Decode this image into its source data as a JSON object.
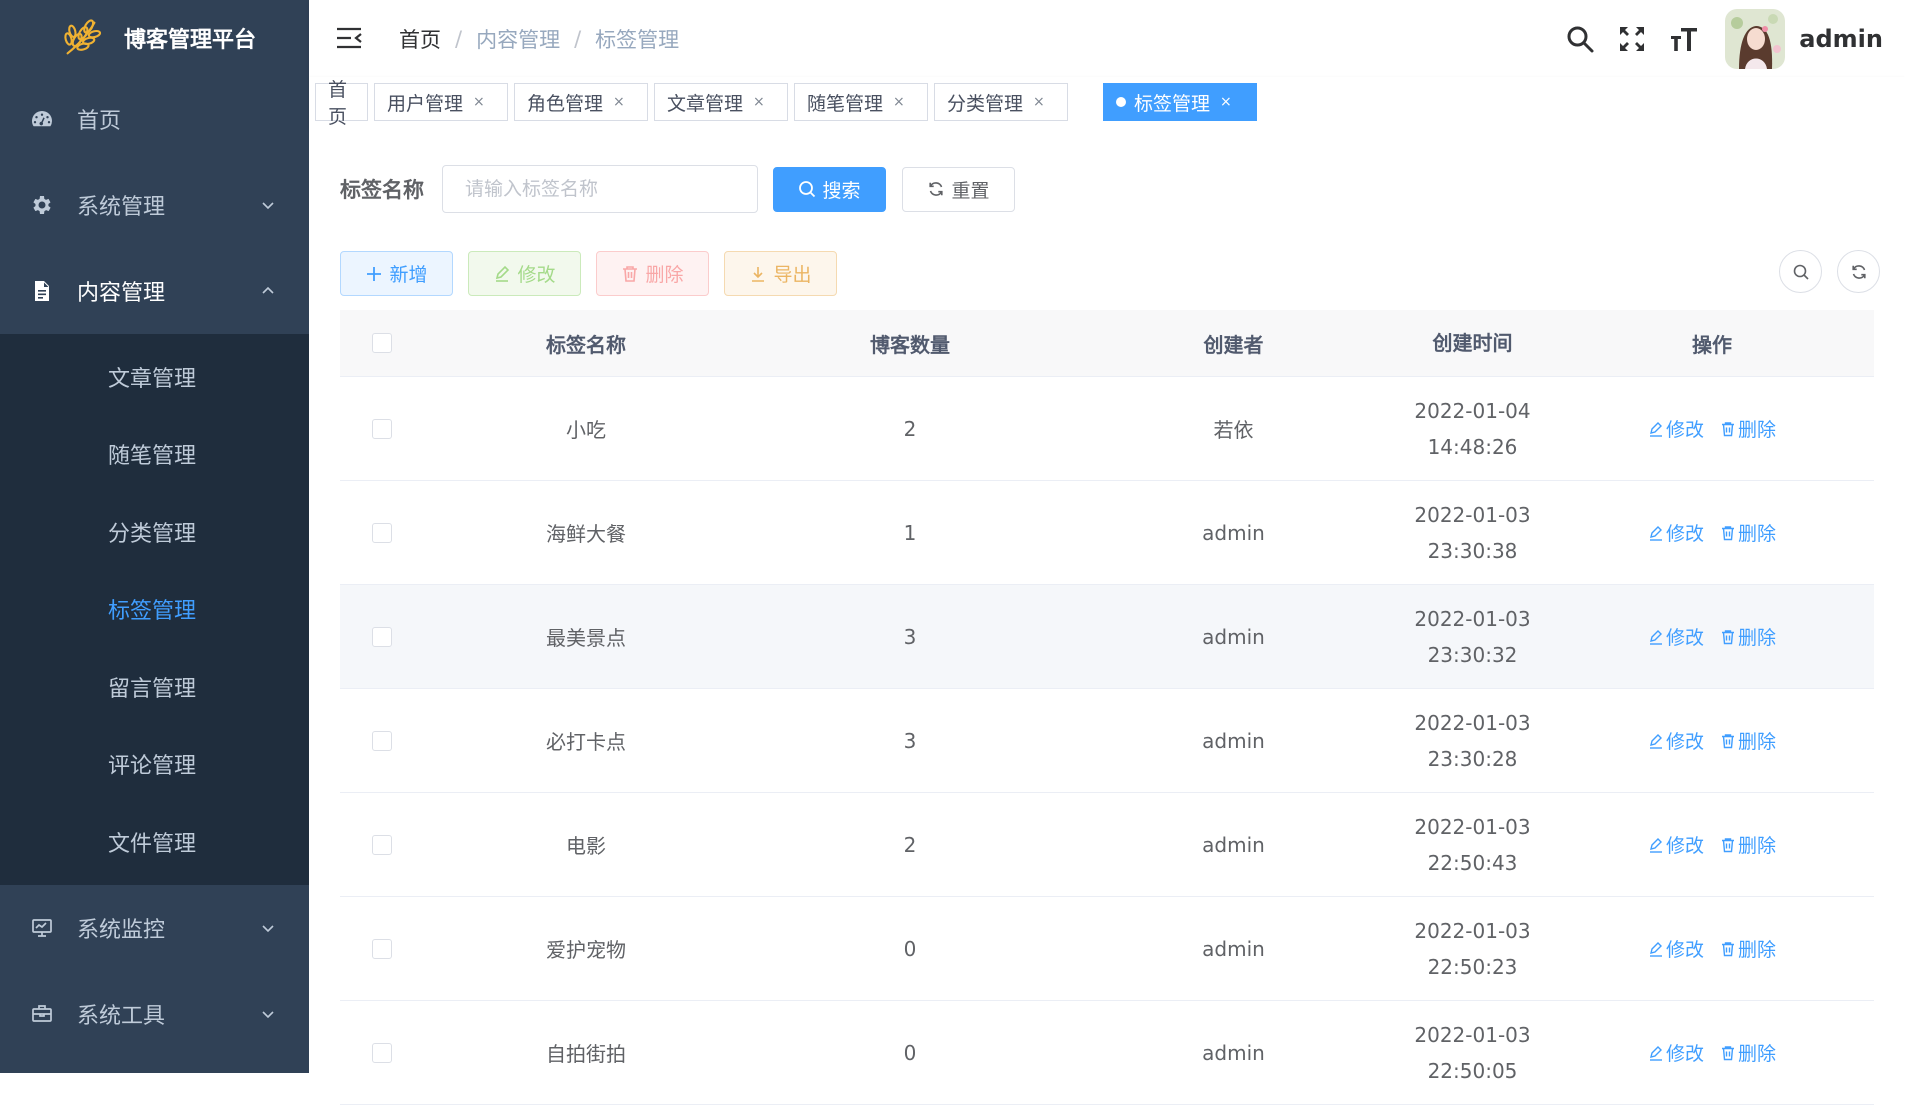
{
  "app": {
    "title": "博客管理平台"
  },
  "sidebar": {
    "items": [
      {
        "label": "首页",
        "icon": "dashboard-icon"
      },
      {
        "label": "系统管理",
        "icon": "gear-icon"
      },
      {
        "label": "内容管理",
        "icon": "document-icon"
      },
      {
        "label": "系统监控",
        "icon": "monitor-icon"
      },
      {
        "label": "系统工具",
        "icon": "toolbox-icon"
      }
    ],
    "content_submenu": [
      "文章管理",
      "随笔管理",
      "分类管理",
      "标签管理",
      "留言管理",
      "评论管理",
      "文件管理"
    ],
    "active_subitem": "标签管理"
  },
  "navbar": {
    "breadcrumb": [
      "首页",
      "内容管理",
      "标签管理"
    ],
    "separator": "/",
    "username": "admin"
  },
  "tags_view": {
    "tabs": [
      {
        "label": "首页",
        "closable": false,
        "active": false
      },
      {
        "label": "用户管理",
        "closable": true,
        "active": false
      },
      {
        "label": "角色管理",
        "closable": true,
        "active": false
      },
      {
        "label": "文章管理",
        "closable": true,
        "active": false
      },
      {
        "label": "随笔管理",
        "closable": true,
        "active": false
      },
      {
        "label": "分类管理",
        "closable": true,
        "active": false
      },
      {
        "label": "标签管理",
        "closable": true,
        "active": true
      }
    ],
    "close_glyph": "×"
  },
  "search": {
    "label": "标签名称",
    "placeholder": "请输入标签名称",
    "search_button": "搜索",
    "reset_button": "重置"
  },
  "toolbar": {
    "add": "新增",
    "edit": "修改",
    "delete": "删除",
    "export": "导出"
  },
  "table": {
    "headers": [
      "标签名称",
      "博客数量",
      "创建者",
      "创建时间",
      "操作"
    ],
    "rows": [
      {
        "name": "小吃",
        "count": "2",
        "creator": "若依",
        "date": "2022-01-04",
        "time": "14:48:26"
      },
      {
        "name": "海鲜大餐",
        "count": "1",
        "creator": "admin",
        "date": "2022-01-03",
        "time": "23:30:38"
      },
      {
        "name": "最美景点",
        "count": "3",
        "creator": "admin",
        "date": "2022-01-03",
        "time": "23:30:32"
      },
      {
        "name": "必打卡点",
        "count": "3",
        "creator": "admin",
        "date": "2022-01-03",
        "time": "23:30:28"
      },
      {
        "name": "电影",
        "count": "2",
        "creator": "admin",
        "date": "2022-01-03",
        "time": "22:50:43"
      },
      {
        "name": "爱护宠物",
        "count": "0",
        "creator": "admin",
        "date": "2022-01-03",
        "time": "22:50:23"
      },
      {
        "name": "自拍街拍",
        "count": "0",
        "creator": "admin",
        "date": "2022-01-03",
        "time": "22:50:05"
      }
    ],
    "op_edit": "修改",
    "op_delete": "删除"
  },
  "colors": {
    "sidebar_bg": "#304156",
    "submenu_bg": "#1f2d3d",
    "primary": "#409eff"
  }
}
